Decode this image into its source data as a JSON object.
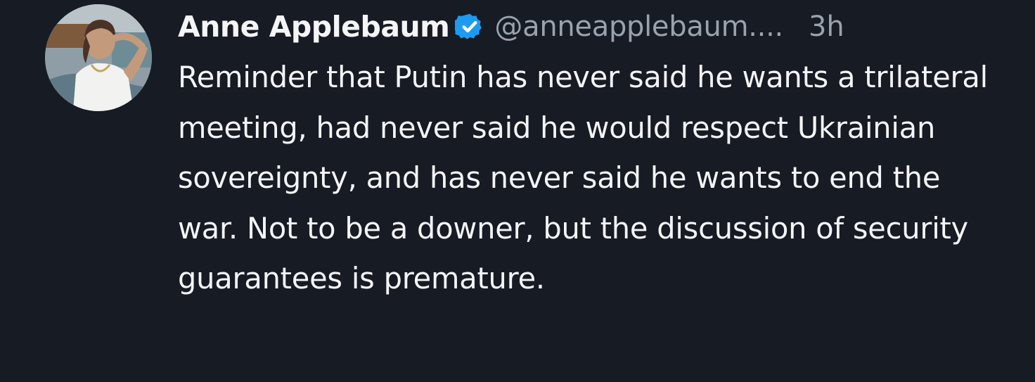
{
  "post": {
    "author": {
      "display_name": "Anne Applebaum",
      "verified": true,
      "verified_icon": "verified-badge-icon",
      "handle": "@anneapplebaum....",
      "avatar": "profile-photo"
    },
    "timestamp": "3h",
    "text": "Reminder that Putin has never said he wants a trilateral meeting, had never said he would respect Ukrainian sovereignty, and has never said he wants to end the war. Not to be a downer, but the discussion of security guarantees is premature."
  },
  "colors": {
    "background": "#161b24",
    "text_primary": "#f4f5f7",
    "text_secondary": "#9aa3ad",
    "verified_accent": "#1d9bf0"
  }
}
